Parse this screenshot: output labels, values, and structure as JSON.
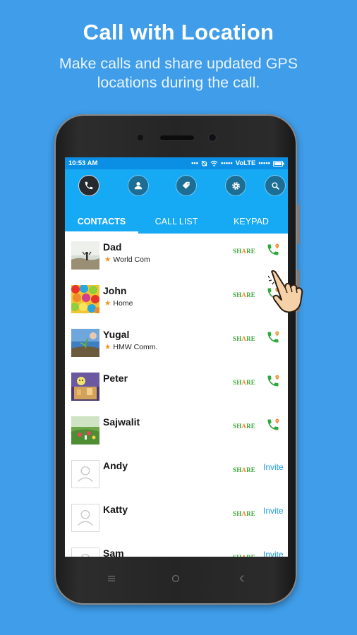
{
  "header": {
    "title": "Call with Location",
    "subtitle_line1": "Make calls and share updated GPS",
    "subtitle_line2": "locations during the call."
  },
  "status_bar": {
    "time": "10:53 AM",
    "network": "VoLTE"
  },
  "toolbar": {
    "icons": [
      "phone-icon",
      "contact-icon",
      "tag-icon",
      "settings-icon",
      "search-icon"
    ]
  },
  "tabs": [
    {
      "label": "CONTACTS",
      "selected": true
    },
    {
      "label": "CALL LIST",
      "selected": false
    },
    {
      "label": "KEYPAD",
      "selected": false
    }
  ],
  "share_label": "SHARE",
  "contacts": [
    {
      "name": "Dad",
      "org": "World Com",
      "action": "call"
    },
    {
      "name": "John",
      "org": "Home",
      "action": "call"
    },
    {
      "name": "Yugal",
      "org": "HMW Comm.",
      "action": "call"
    },
    {
      "name": "Peter",
      "org": "",
      "action": "call"
    },
    {
      "name": "Sajwalit",
      "org": "",
      "action": "call"
    },
    {
      "name": "Andy",
      "org": "",
      "action": "invite",
      "action_label": "Invite"
    },
    {
      "name": "Katty",
      "org": "",
      "action": "invite",
      "action_label": "Invite"
    },
    {
      "name": "Sam",
      "org": "",
      "action": "invite",
      "action_label": "Invite"
    }
  ],
  "colors": {
    "background": "#3f9de9",
    "app_bar": "#16a9f4",
    "status_bar": "#0b8fe4",
    "share_green": "#3aa63a",
    "invite_blue": "#1a9ae8",
    "star_orange": "#f0921e"
  }
}
